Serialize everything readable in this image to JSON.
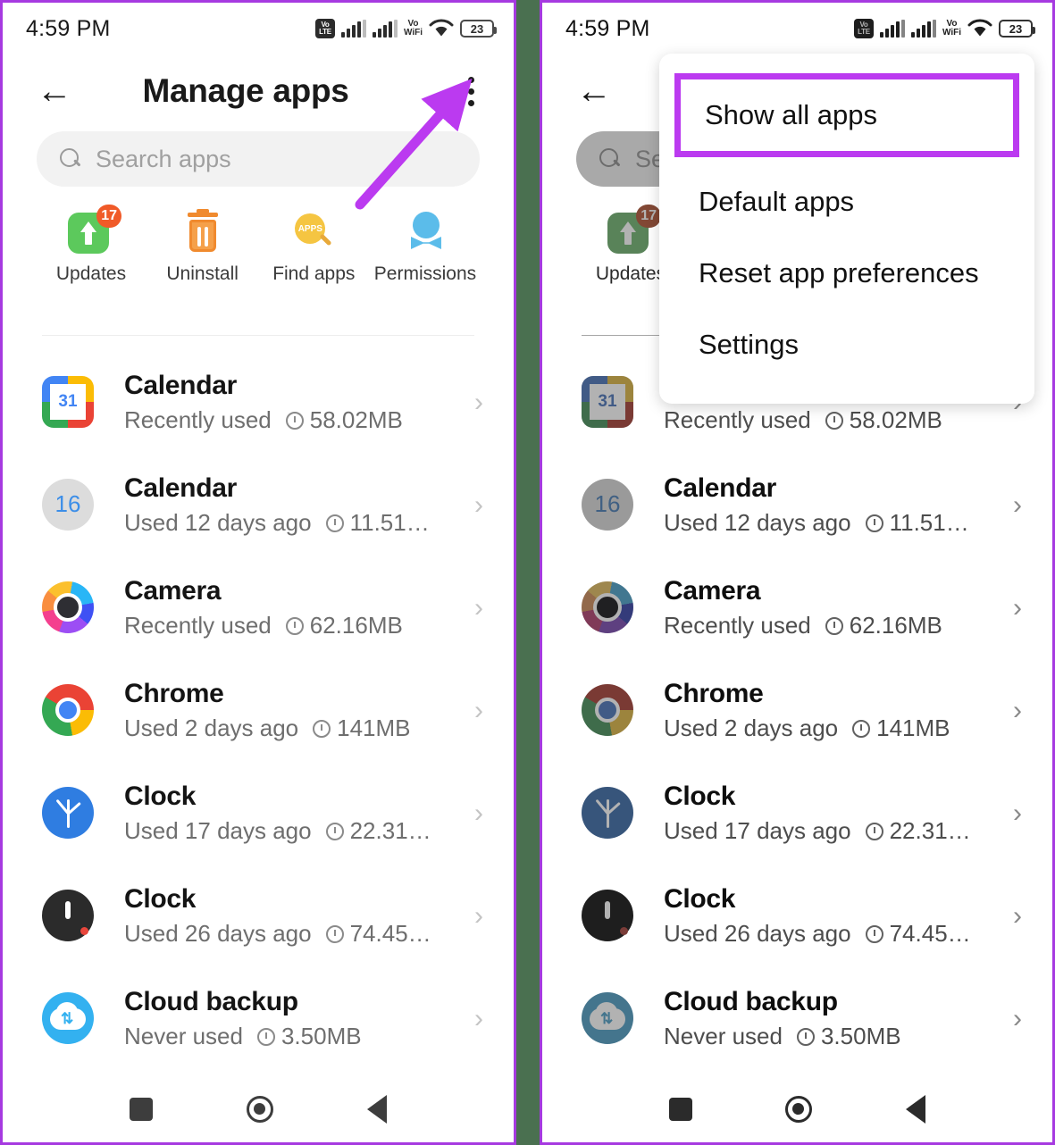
{
  "accent": {
    "purple": "#bb3af0",
    "divider_green": "#4a7050",
    "badge_orange": "#f05a28"
  },
  "status_bar": {
    "time": "4:59 PM",
    "volte_top": "Vo",
    "volte_bottom": "LTE",
    "vowifi_top": "Vo",
    "vowifi_bottom": "WiFi",
    "battery_percent": "23",
    "icons": [
      "volte-badge",
      "signal-bars-sim1",
      "signal-bars-sim2",
      "vowifi-icon",
      "wifi-icon",
      "battery-icon"
    ]
  },
  "app_bar": {
    "back_icon": "back-arrow-icon",
    "title": "Manage apps",
    "overflow_icon": "kebab-menu-icon"
  },
  "search": {
    "placeholder": "Search apps",
    "icon": "search-icon"
  },
  "quick_actions": [
    {
      "label": "Updates",
      "icon": "updates-icon",
      "badge": "17"
    },
    {
      "label": "Uninstall",
      "icon": "trash-icon",
      "badge": ""
    },
    {
      "label": "Find apps",
      "icon": "find-apps-icon",
      "badge": ""
    },
    {
      "label": "Permissions",
      "icon": "permissions-icon",
      "badge": ""
    }
  ],
  "find_apps_icon_text": "APPS",
  "app_list": [
    {
      "name": "Calendar",
      "used": "Recently used",
      "size": "58.02MB",
      "icon": "google-calendar-icon",
      "icon_day": "31"
    },
    {
      "name": "Calendar",
      "used": "Used 12 days ago",
      "size": "11.51…",
      "icon": "calendar-16-icon",
      "icon_day": "16"
    },
    {
      "name": "Camera",
      "used": "Recently used",
      "size": "62.16MB",
      "icon": "camera-icon",
      "icon_day": ""
    },
    {
      "name": "Chrome",
      "used": "Used 2 days ago",
      "size": "141MB",
      "icon": "chrome-icon",
      "icon_day": ""
    },
    {
      "name": "Clock",
      "used": "Used 17 days ago",
      "size": "22.31…",
      "icon": "clock-blue-icon",
      "icon_day": ""
    },
    {
      "name": "Clock",
      "used": "Used 26 days ago",
      "size": "74.45…",
      "icon": "clock-dark-icon",
      "icon_day": ""
    },
    {
      "name": "Cloud backup",
      "used": "Never used",
      "size": "3.50MB",
      "icon": "cloud-backup-icon",
      "icon_day": ""
    }
  ],
  "row_chevron": "›",
  "overflow_menu": {
    "items": [
      {
        "label": "Show all apps",
        "highlighted": true
      },
      {
        "label": "Default apps",
        "highlighted": false
      },
      {
        "label": "Reset app preferences",
        "highlighted": false
      },
      {
        "label": "Settings",
        "highlighted": false
      }
    ]
  },
  "nav_bar": {
    "recents": "recents-square-icon",
    "home": "home-circle-icon",
    "back": "back-triangle-icon"
  },
  "annotation": {
    "arrow": "callout-arrow-icon"
  }
}
